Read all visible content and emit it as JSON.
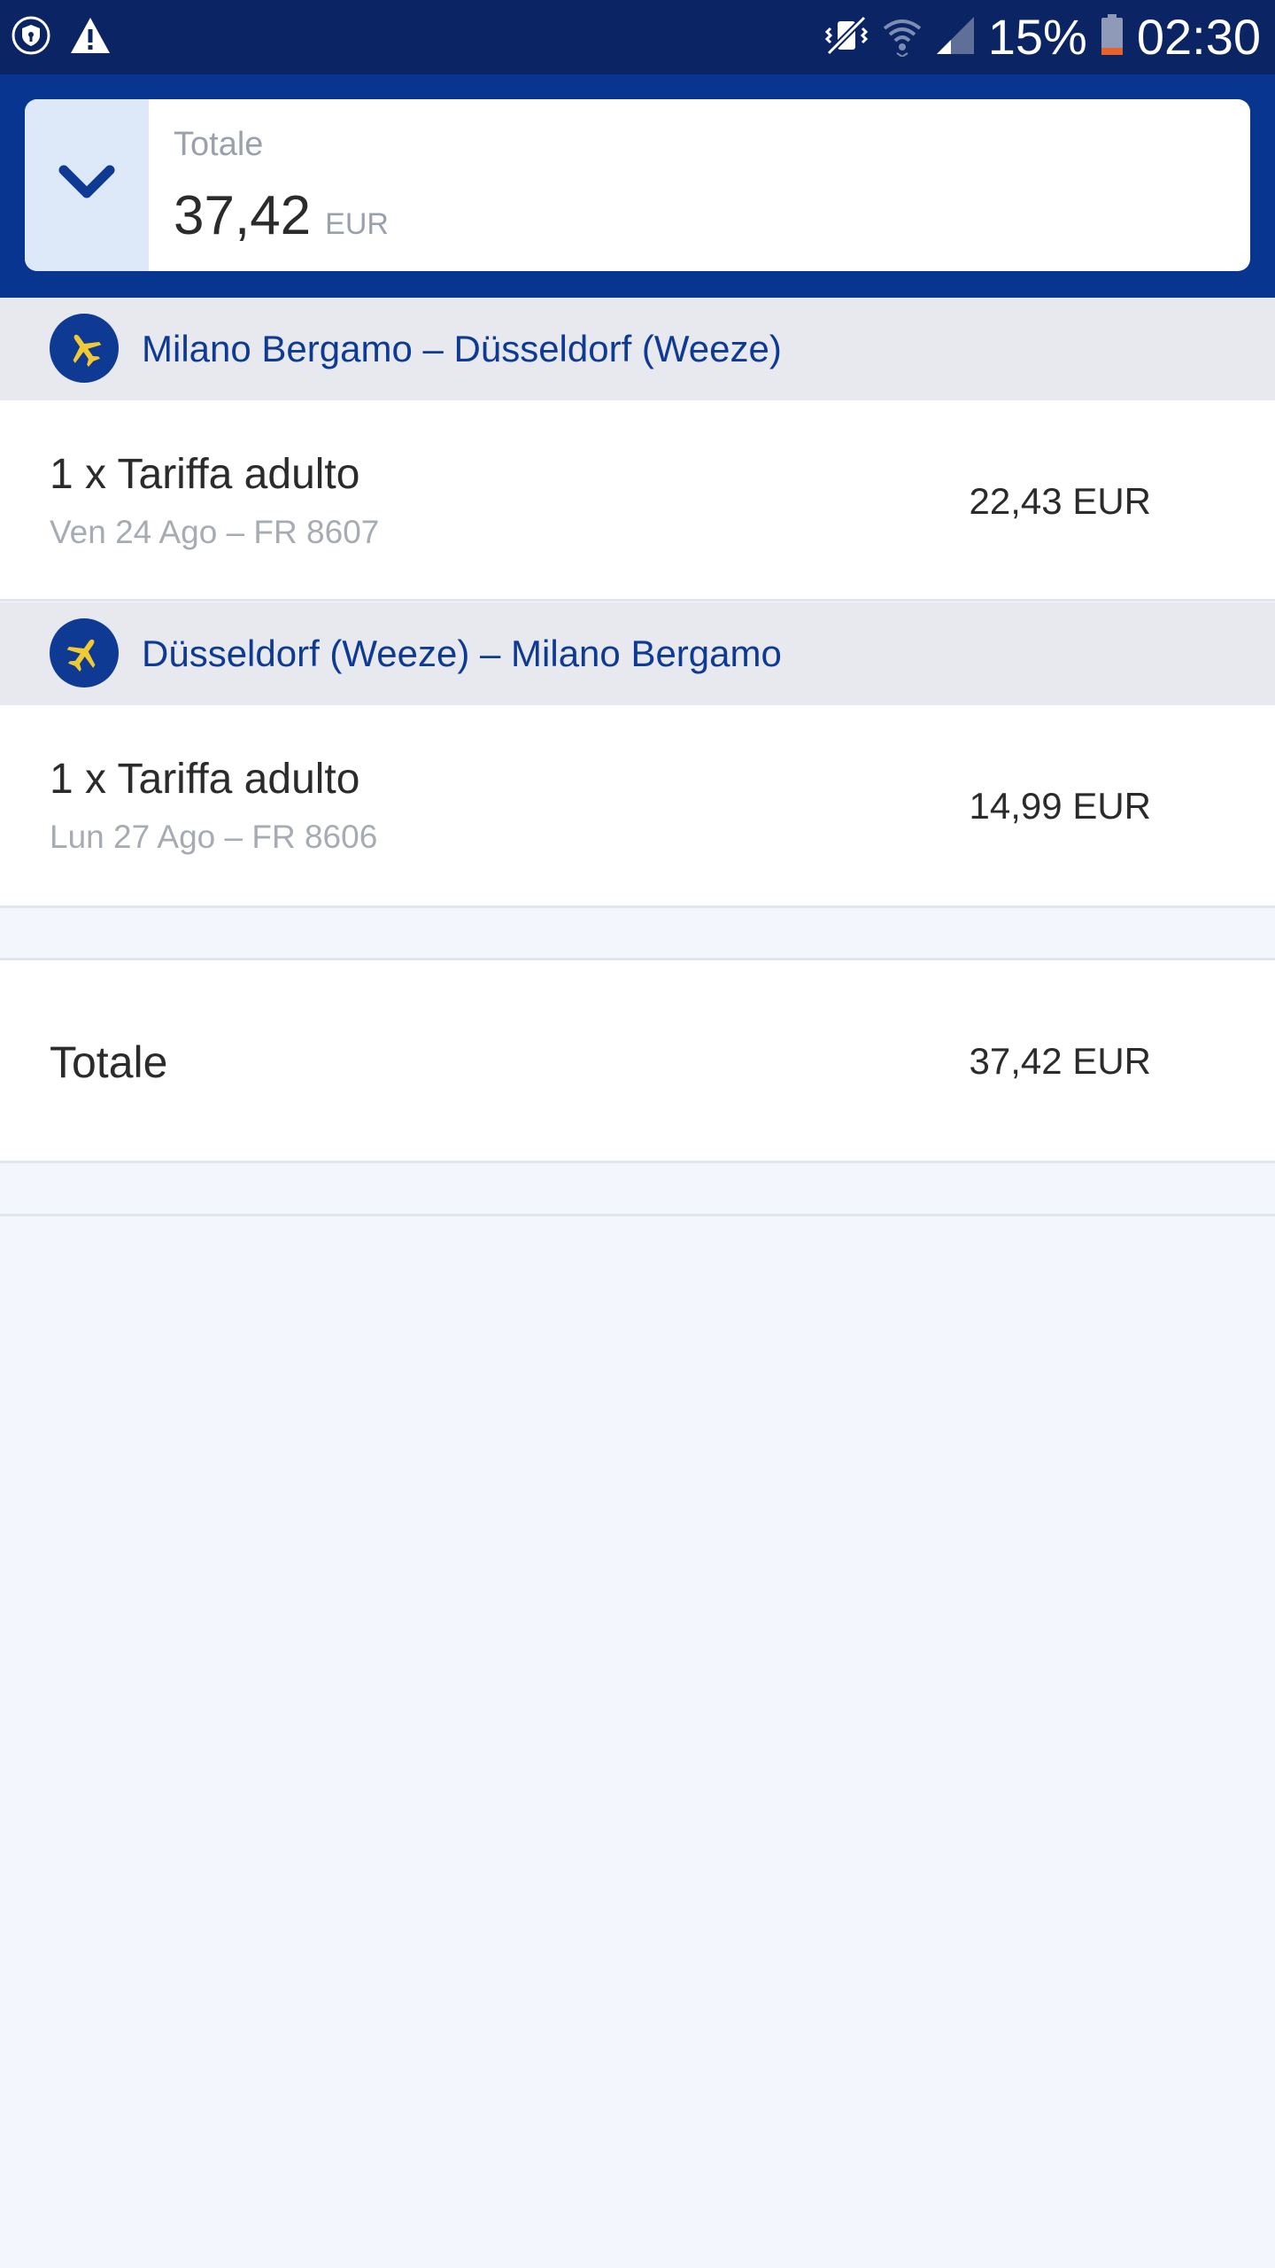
{
  "status_bar": {
    "battery_percent": "15%",
    "time": "02:30",
    "icons": [
      "shield-notification-icon",
      "warning-icon",
      "vibrate-mute-icon",
      "wifi-icon",
      "signal-icon",
      "battery-icon"
    ]
  },
  "summary": {
    "label": "Totale",
    "amount": "37,42",
    "currency": "EUR",
    "toggle_icon": "chevron-down-icon"
  },
  "flights": [
    {
      "icon": "plane-icon",
      "route": "Milano Bergamo – Düsseldorf (Weeze)",
      "fare": {
        "title": "1 x Tariffa adulto",
        "details": "Ven 24 Ago – FR 8607",
        "price": "22,43 EUR"
      }
    },
    {
      "icon": "plane-icon",
      "route": "Düsseldorf (Weeze) – Milano Bergamo",
      "fare": {
        "title": "1 x Tariffa adulto",
        "details": "Lun 27 Ago – FR 8606",
        "price": "14,99 EUR"
      }
    }
  ],
  "total": {
    "label": "Totale",
    "value": "37,42 EUR"
  },
  "colors": {
    "status_bar": "#0b2463",
    "brand_blue": "#073590",
    "accent_yellow": "#f1c933",
    "page_background": "#f3f6fc"
  }
}
